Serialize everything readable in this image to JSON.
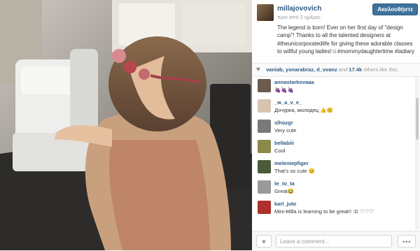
{
  "post": {
    "username": "millajovovich",
    "time": "πριν από 2 ημέρες",
    "follow_label": "Ακολουθήστε",
    "caption": "The legend is born! Ever on her first day of \"design camp\"! Thanks to all the talented designers at #theunicorporatedlife for giving these adorable classes to willful young ladies!☺#mommydaughtertime #ladiary"
  },
  "likes": {
    "names": "vaniab, yonarabraz, d_vvanz",
    "and_text": "and",
    "count": "17.4k",
    "suffix": "others like this."
  },
  "comments": [
    {
      "user": "annastarkovaaa",
      "text": "🍇🍇🍇",
      "avatar_color": "#6b5b4f"
    },
    {
      "user": "_w_a_v_e_",
      "text": "Дочурка, молодец 👍😊",
      "avatar_color": "#d6c3b0"
    },
    {
      "user": "slhozgr",
      "text": "Very cute",
      "avatar_color": "#7a7a7a"
    },
    {
      "user": "bellabiii",
      "text": "Cool",
      "avatar_color": "#8c8a4a"
    },
    {
      "user": "meleniepfiger",
      "text": "That's so cute 😊",
      "avatar_color": "#4a5a3a"
    },
    {
      "user": "te_to_ta",
      "text": "Great😂",
      "avatar_color": "#9a9a9a"
    },
    {
      "user": "karl_juto",
      "text": "Mini-Milla is learning to be great!! :D ♡♡♡",
      "avatar_color": "#b0302c"
    }
  ],
  "footer": {
    "comment_placeholder": "Leave a comment...",
    "more_label": "•••"
  },
  "icons": {
    "like": "heart-icon",
    "more": "ellipsis-icon"
  },
  "colors": {
    "link": "#2f5b85",
    "button": "#3f729b"
  }
}
